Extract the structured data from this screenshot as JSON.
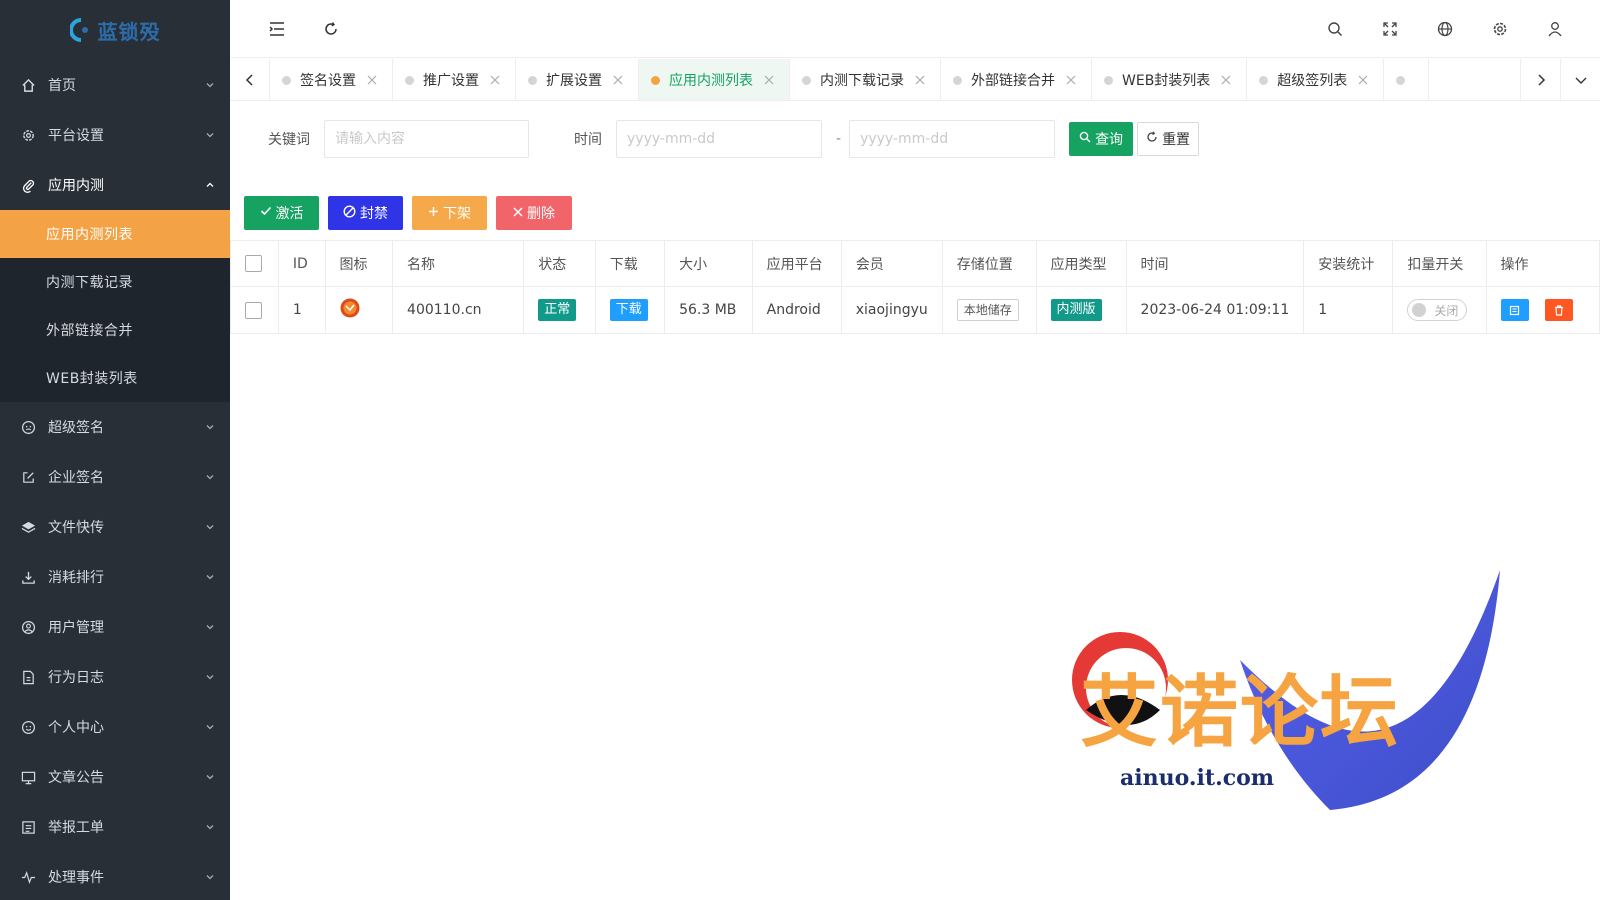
{
  "brand": {
    "name": "蓝锁殁",
    "sub": ""
  },
  "sidebar": {
    "items": [
      {
        "label": "首页",
        "icon": "home-icon"
      },
      {
        "label": "平台设置",
        "icon": "gear-icon"
      },
      {
        "label": "应用内测",
        "icon": "paperclip-icon",
        "open": true,
        "children": [
          {
            "label": "应用内测列表",
            "active": true
          },
          {
            "label": "内测下载记录"
          },
          {
            "label": "外部链接合并"
          },
          {
            "label": "WEB封装列表"
          }
        ]
      },
      {
        "label": "超级签名",
        "icon": "smile-icon"
      },
      {
        "label": "企业签名",
        "icon": "edit-icon"
      },
      {
        "label": "文件快传",
        "icon": "layers-icon"
      },
      {
        "label": "消耗排行",
        "icon": "download-icon"
      },
      {
        "label": "用户管理",
        "icon": "user-circle-icon"
      },
      {
        "label": "行为日志",
        "icon": "file-icon"
      },
      {
        "label": "个人中心",
        "icon": "smile-icon"
      },
      {
        "label": "文章公告",
        "icon": "monitor-icon"
      },
      {
        "label": "举报工单",
        "icon": "list-icon"
      },
      {
        "label": "处理事件",
        "icon": "pulse-icon"
      }
    ]
  },
  "tabs": [
    {
      "label": "签名设置"
    },
    {
      "label": "推广设置"
    },
    {
      "label": "扩展设置"
    },
    {
      "label": "应用内测列表",
      "active": true
    },
    {
      "label": "内测下载记录"
    },
    {
      "label": "外部链接合并"
    },
    {
      "label": "WEB封装列表"
    },
    {
      "label": "超级签列表"
    }
  ],
  "search": {
    "keyword_label": "关键词",
    "keyword_placeholder": "请输入内容",
    "time_label": "时间",
    "date_placeholder": "yyyy-mm-dd",
    "separator": "-",
    "query_label": "查询",
    "reset_label": "重置"
  },
  "actions": {
    "activate": "激活",
    "ban": "封禁",
    "unlist": "下架",
    "delete": "删除"
  },
  "table": {
    "columns": [
      "ID",
      "图标",
      "名称",
      "状态",
      "下载",
      "大小",
      "应用平台",
      "会员",
      "存储位置",
      "应用类型",
      "时间",
      "安装统计",
      "扣量开关",
      "操作"
    ],
    "rows": [
      {
        "id": "1",
        "name": "400110.cn",
        "status": "正常",
        "download": "下载",
        "size": "56.3 MB",
        "platform": "Android",
        "member": "xiaojingyu",
        "storage": "本地储存",
        "type": "内测版",
        "time": "2023-06-24 01:09:11",
        "installs": "1",
        "deduct": "关闭"
      }
    ]
  },
  "watermark": {
    "title": "艾诺论坛",
    "url": "ainuo.it.com"
  },
  "colors": {
    "sidebar": "#282f37",
    "accent": "#f3a245",
    "primary": "#16a261"
  }
}
